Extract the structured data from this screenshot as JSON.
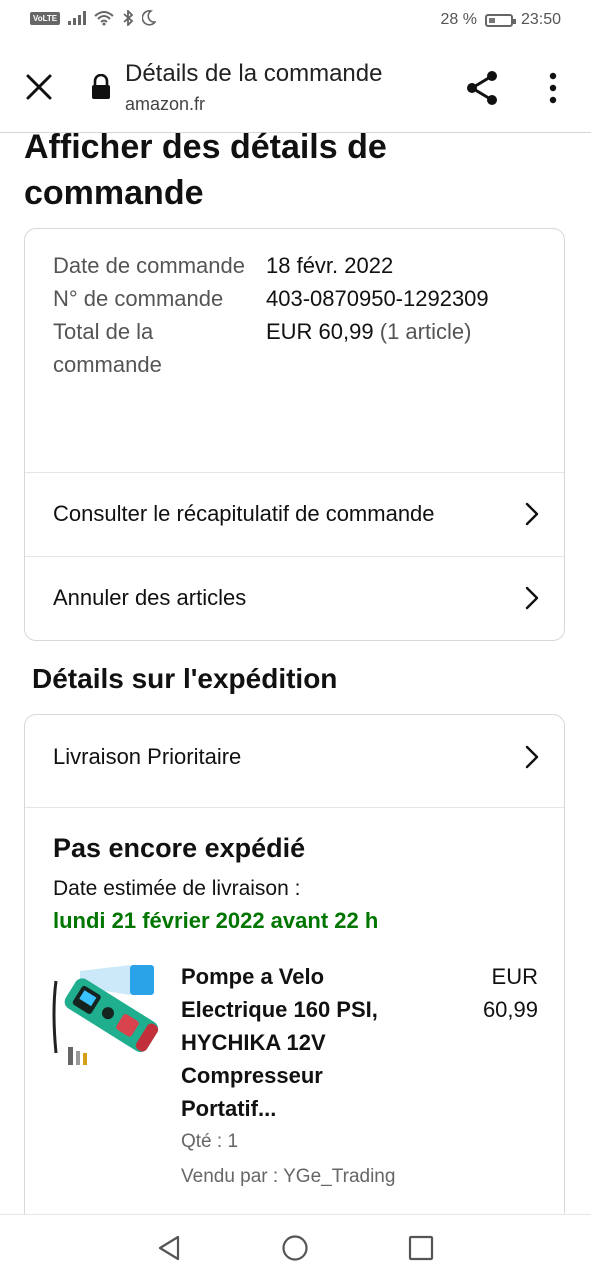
{
  "status_bar": {
    "volte": "VoLTE",
    "battery_text": "28 %",
    "battery_level": 0.28,
    "time": "23:50",
    "icons": [
      "signal-icon",
      "wifi-icon",
      "bluetooth-icon",
      "moon-icon",
      "battery-icon"
    ]
  },
  "toolbar": {
    "title": "Détails de la commande",
    "domain": "amazon.fr",
    "icons": [
      "close-icon",
      "lock-icon",
      "share-icon",
      "more-vert-icon"
    ]
  },
  "page": {
    "title": "Afficher des détails de commande"
  },
  "order": {
    "rows": [
      {
        "label": "Date de commande",
        "value": "18 févr. 2022",
        "extra": ""
      },
      {
        "label": "N° de commande",
        "value": "403-0870950-1292309",
        "extra": ""
      },
      {
        "label": "Total de la commande",
        "value": "EUR 60,99",
        "extra": " (1 article)"
      }
    ],
    "links": [
      {
        "label": "Consulter le récapitulatif de commande"
      },
      {
        "label": "Annuler des articles"
      }
    ]
  },
  "shipping": {
    "section_title": "Détails sur l'expédition",
    "method": "Livraison Prioritaire",
    "status": "Pas encore expédié",
    "estimate_label": "Date estimée de livraison :",
    "estimate_date": "lundi 21 février 2022 avant 22 h",
    "estimate_color": "#007600",
    "item": {
      "title": "Pompe a Velo Electrique 160 PSI, HYCHIKA 12V Compresseur Portatif...",
      "price": "EUR 60,99",
      "qty": "Qté : 1",
      "seller": "Vendu par : YGe_Trading"
    }
  },
  "nav": {
    "icons": [
      "back-icon",
      "home-icon",
      "recents-icon"
    ]
  }
}
